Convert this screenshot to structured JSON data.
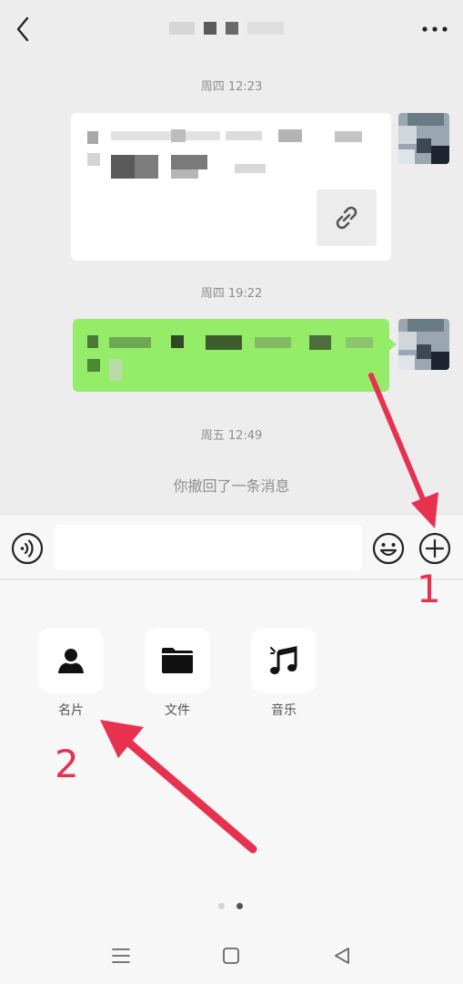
{
  "header": {
    "back_icon": "chevron-left-icon",
    "more_icon": "more-dots-icon"
  },
  "chat": {
    "timestamps": [
      "周四 12:23",
      "周四 19:22",
      "周五 12:49"
    ],
    "recall_notice": "你撤回了一条消息"
  },
  "input_bar": {
    "voice_icon": "voice-icon",
    "text_value": "",
    "emoji_icon": "emoji-icon",
    "plus_icon": "plus-circle-icon"
  },
  "panel": {
    "tools": [
      {
        "label": "名片",
        "icon": "contact-card-icon"
      },
      {
        "label": "文件",
        "icon": "folder-icon"
      },
      {
        "label": "音乐",
        "icon": "music-icon"
      }
    ],
    "page_count": 2,
    "active_page": 2
  },
  "annotations": {
    "step1": "1",
    "step2": "2",
    "color": "#e63250"
  },
  "colors": {
    "bubble_green": "#95ec69",
    "background": "#ededed"
  }
}
